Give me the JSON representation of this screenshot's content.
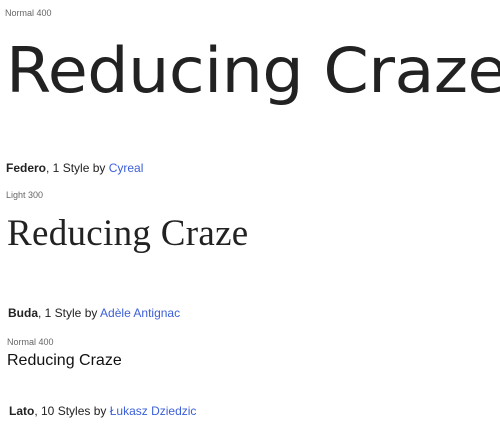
{
  "fonts": [
    {
      "style_label": "Normal 400",
      "sample": "Reducing Craze",
      "name": "Federo",
      "styles": ", 1 Style by ",
      "author": "Cyreal"
    },
    {
      "style_label": "Light 300",
      "sample": "Reducing Craze",
      "name": "Buda",
      "styles": ", 1 Style by ",
      "author": "Adèle Antignac"
    },
    {
      "style_label": "Normal 400",
      "sample": "Reducing Craze",
      "name": "Lato",
      "styles": ", 10 Styles by ",
      "author": "Łukasz Dziedzic"
    }
  ],
  "colors": {
    "link": "#3b5fd9",
    "label": "#666666",
    "text": "#222222"
  }
}
